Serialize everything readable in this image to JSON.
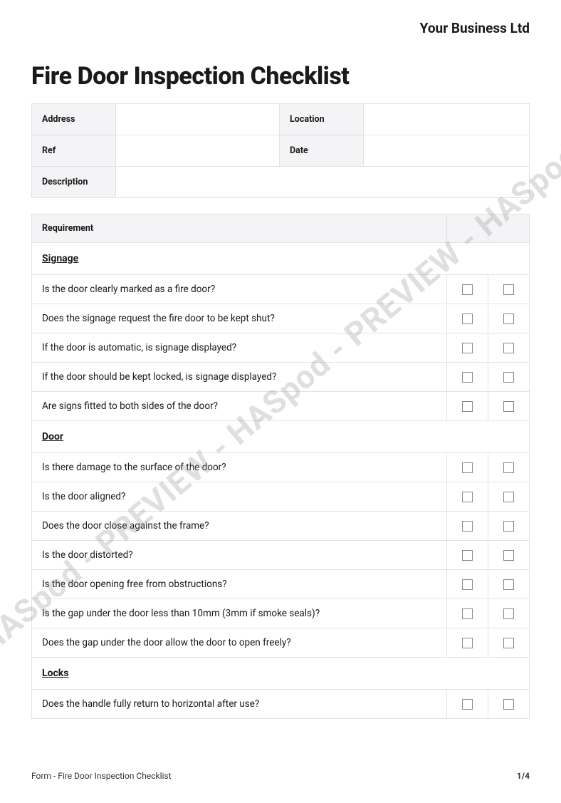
{
  "company": "Your Business Ltd",
  "title": "Fire Door Inspection Checklist",
  "meta": {
    "address_label": "Address",
    "location_label": "Location",
    "ref_label": "Ref",
    "date_label": "Date",
    "description_label": "Description"
  },
  "header": {
    "requirement": "Requirement"
  },
  "sections": {
    "signage": "Signage",
    "door": "Door",
    "locks": "Locks"
  },
  "items": {
    "sig1": "Is the door clearly marked as a fire door?",
    "sig2": "Does the signage request the fire door to be kept shut?",
    "sig3": "If the door is automatic, is signage displayed?",
    "sig4": "If the door should be kept locked, is signage displayed?",
    "sig5": "Are signs fitted to both sides of the door?",
    "door1": "Is there damage to the surface of the door?",
    "door2": "Is the door aligned?",
    "door3": "Does the door close against the frame?",
    "door4": "Is the door distorted?",
    "door5": "Is the door opening free from obstructions?",
    "door6": "Is the gap under the door less than 10mm (3mm if smoke seals)?",
    "door7": "Does the gap under the door allow the door to open freely?",
    "lock1": "Does the handle fully return to horizontal after use?"
  },
  "footer": {
    "form": "Form - Fire Door Inspection Checklist",
    "page": "1/4"
  },
  "watermark": "d - PREVIEW - HASpod - PREVIEW - HASpod - PREVIEW - HASpod - PREVIEW - H"
}
